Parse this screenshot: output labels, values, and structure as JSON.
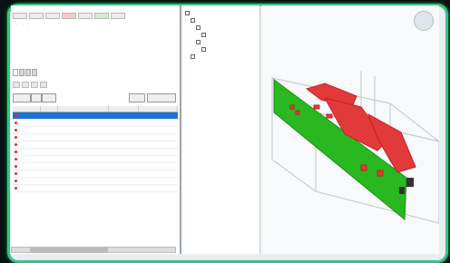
{
  "app": {
    "toolbar_buttons": [
      {
        "label": "",
        "style": "normal"
      },
      {
        "label": "",
        "style": "normal"
      },
      {
        "label": "",
        "style": "normal"
      },
      {
        "label": "",
        "style": "hot"
      },
      {
        "label": "",
        "style": "normal"
      },
      {
        "label": "",
        "style": "green"
      },
      {
        "label": "",
        "style": "normal"
      }
    ]
  },
  "left": {
    "tabs": [
      {
        "label": "",
        "active": true
      },
      {
        "label": "",
        "active": false
      },
      {
        "label": "",
        "active": false
      },
      {
        "label": "",
        "active": false
      }
    ],
    "subtabs": [
      "",
      "",
      "",
      ""
    ],
    "table": {
      "columns": [
        "",
        "",
        "",
        "",
        ""
      ],
      "rows": [
        {
          "a": "",
          "b": "",
          "c": "",
          "d": "",
          "e": "",
          "selected": true
        },
        {
          "a": "",
          "b": "",
          "c": "",
          "d": "",
          "e": "",
          "selected": false
        },
        {
          "a": "",
          "b": "",
          "c": "",
          "d": "",
          "e": "",
          "selected": false
        },
        {
          "a": "",
          "b": "",
          "c": "",
          "d": "",
          "e": "",
          "selected": false
        },
        {
          "a": "",
          "b": "",
          "c": "",
          "d": "",
          "e": "",
          "selected": false
        },
        {
          "a": "",
          "b": "",
          "c": "",
          "d": "",
          "e": "",
          "selected": false
        },
        {
          "a": "",
          "b": "",
          "c": "",
          "d": "",
          "e": "",
          "selected": false
        },
        {
          "a": "",
          "b": "",
          "c": "",
          "d": "",
          "e": "",
          "selected": false
        },
        {
          "a": "",
          "b": "",
          "c": "",
          "d": "",
          "e": "",
          "selected": false
        },
        {
          "a": "",
          "b": "",
          "c": "",
          "d": "",
          "e": "",
          "selected": false
        },
        {
          "a": "",
          "b": "",
          "c": "",
          "d": "",
          "e": "",
          "selected": false
        }
      ]
    }
  },
  "tree": {
    "items": [
      {
        "label": "",
        "indent": 0
      },
      {
        "label": "",
        "indent": 1
      },
      {
        "label": "",
        "indent": 2
      },
      {
        "label": "",
        "indent": 3
      },
      {
        "label": "",
        "indent": 2
      },
      {
        "label": "",
        "indent": 3
      },
      {
        "label": "",
        "indent": 1
      }
    ]
  },
  "colors": {
    "accent_green": "#3ac08c",
    "selection_blue": "#1e74d8",
    "model_red": "#e23a3a",
    "model_green": "#29b820"
  }
}
